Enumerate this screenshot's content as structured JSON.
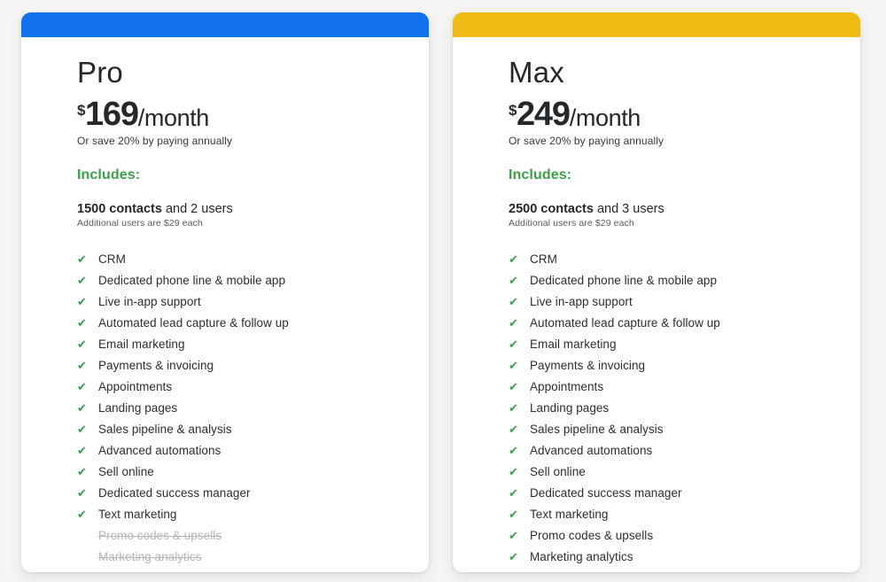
{
  "theme": {
    "page_background": "#f4f4f4",
    "card_background": "#ffffff",
    "include_green": "#3aa04a",
    "check_green": "#3aa04a",
    "text_dark": "#25282b",
    "excluded_gray": "#b6b6b6"
  },
  "plans": [
    {
      "id": "pro",
      "accent_color": "#1271ed",
      "name": "Pro",
      "currency_symbol": "$",
      "price": "169",
      "period": "/month",
      "annual_note": "Or save 20% by paying annually",
      "includes_label": "Includes:",
      "contacts_bold": "1500 contacts",
      "contacts_rest": " and 2 users",
      "additional_users_note": "Additional users are $29 each",
      "check_icon": "✔",
      "features": [
        {
          "label": "CRM",
          "included": true
        },
        {
          "label": "Dedicated phone line & mobile app",
          "included": true
        },
        {
          "label": "Live in-app support",
          "included": true
        },
        {
          "label": "Automated lead capture & follow up",
          "included": true
        },
        {
          "label": "Email marketing",
          "included": true
        },
        {
          "label": "Payments & invoicing",
          "included": true
        },
        {
          "label": "Appointments",
          "included": true
        },
        {
          "label": "Landing pages",
          "included": true
        },
        {
          "label": "Sales pipeline & analysis",
          "included": true
        },
        {
          "label": "Advanced automations",
          "included": true
        },
        {
          "label": "Sell online",
          "included": true
        },
        {
          "label": "Dedicated success manager",
          "included": true
        },
        {
          "label": "Text marketing",
          "included": true
        },
        {
          "label": "Promo codes & upsells",
          "included": false
        },
        {
          "label": "Marketing analytics",
          "included": false
        }
      ]
    },
    {
      "id": "max",
      "accent_color": "#efbb14",
      "name": "Max",
      "currency_symbol": "$",
      "price": "249",
      "period": "/month",
      "annual_note": "Or save 20% by paying annually",
      "includes_label": "Includes:",
      "contacts_bold": "2500 contacts",
      "contacts_rest": " and 3 users",
      "additional_users_note": "Additional users are $29 each",
      "check_icon": "✔",
      "features": [
        {
          "label": "CRM",
          "included": true
        },
        {
          "label": "Dedicated phone line & mobile app",
          "included": true
        },
        {
          "label": "Live in-app support",
          "included": true
        },
        {
          "label": "Automated lead capture & follow up",
          "included": true
        },
        {
          "label": "Email marketing",
          "included": true
        },
        {
          "label": "Payments & invoicing",
          "included": true
        },
        {
          "label": "Appointments",
          "included": true
        },
        {
          "label": "Landing pages",
          "included": true
        },
        {
          "label": "Sales pipeline & analysis",
          "included": true
        },
        {
          "label": "Advanced automations",
          "included": true
        },
        {
          "label": "Sell online",
          "included": true
        },
        {
          "label": "Dedicated success manager",
          "included": true
        },
        {
          "label": "Text marketing",
          "included": true
        },
        {
          "label": "Promo codes & upsells",
          "included": true
        },
        {
          "label": "Marketing analytics",
          "included": true
        }
      ]
    }
  ]
}
